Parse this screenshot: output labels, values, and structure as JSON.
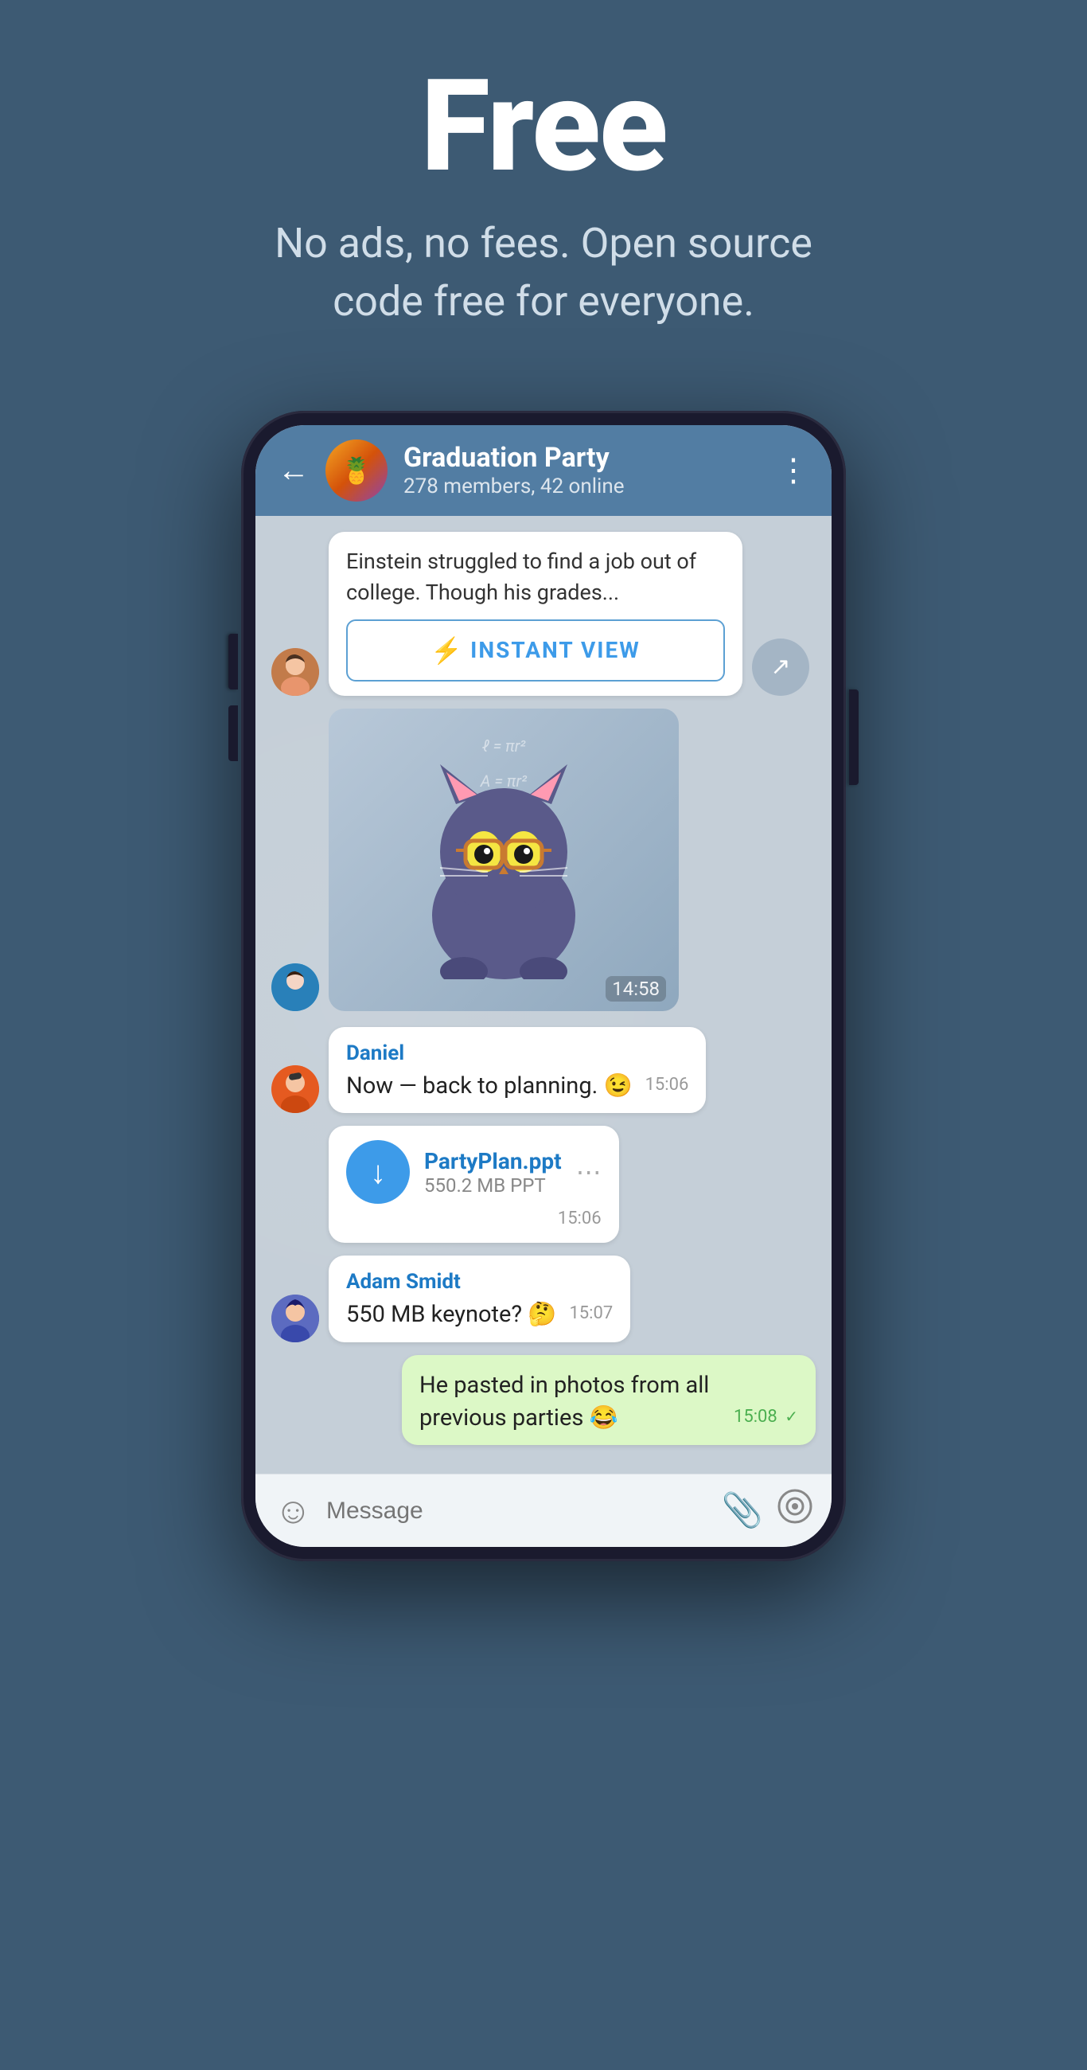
{
  "hero": {
    "title": "Free",
    "subtitle": "No ads, no fees. Open source code free for everyone."
  },
  "chat": {
    "header": {
      "back_label": "←",
      "group_name": "Graduation Party",
      "group_meta": "278 members, 42 online",
      "more_icon": "⋮"
    },
    "messages": [
      {
        "id": "msg1",
        "type": "instant_view",
        "sender_avatar": "girl",
        "preview_text": "Einstein struggled to find a job out of college. Though his grades...",
        "iv_label": "INSTANT VIEW",
        "time": "",
        "own": false
      },
      {
        "id": "msg2",
        "type": "sticker",
        "sender_avatar": "guy1",
        "time": "14:58",
        "own": false
      },
      {
        "id": "msg3",
        "type": "text",
        "sender": "Daniel",
        "sender_avatar": "guy2",
        "text": "Now — back to planning. 😉",
        "time": "15:06",
        "own": false
      },
      {
        "id": "msg4",
        "type": "file",
        "sender_avatar": "guy2",
        "file_name": "PartyPlan.ppt",
        "file_size": "550.2 MB PPT",
        "time": "15:06",
        "own": false
      },
      {
        "id": "msg5",
        "type": "text",
        "sender": "Adam Smidt",
        "sender_avatar": "guy3",
        "text": "550 MB keynote? 🤔",
        "time": "15:07",
        "own": false
      },
      {
        "id": "msg6",
        "type": "text_own",
        "text": "He pasted in photos from all previous parties 😂",
        "time": "15:08",
        "own": true
      }
    ],
    "input": {
      "placeholder": "Message",
      "emoji_icon": "☺",
      "attach_icon": "📎",
      "camera_icon": "⊙"
    }
  }
}
